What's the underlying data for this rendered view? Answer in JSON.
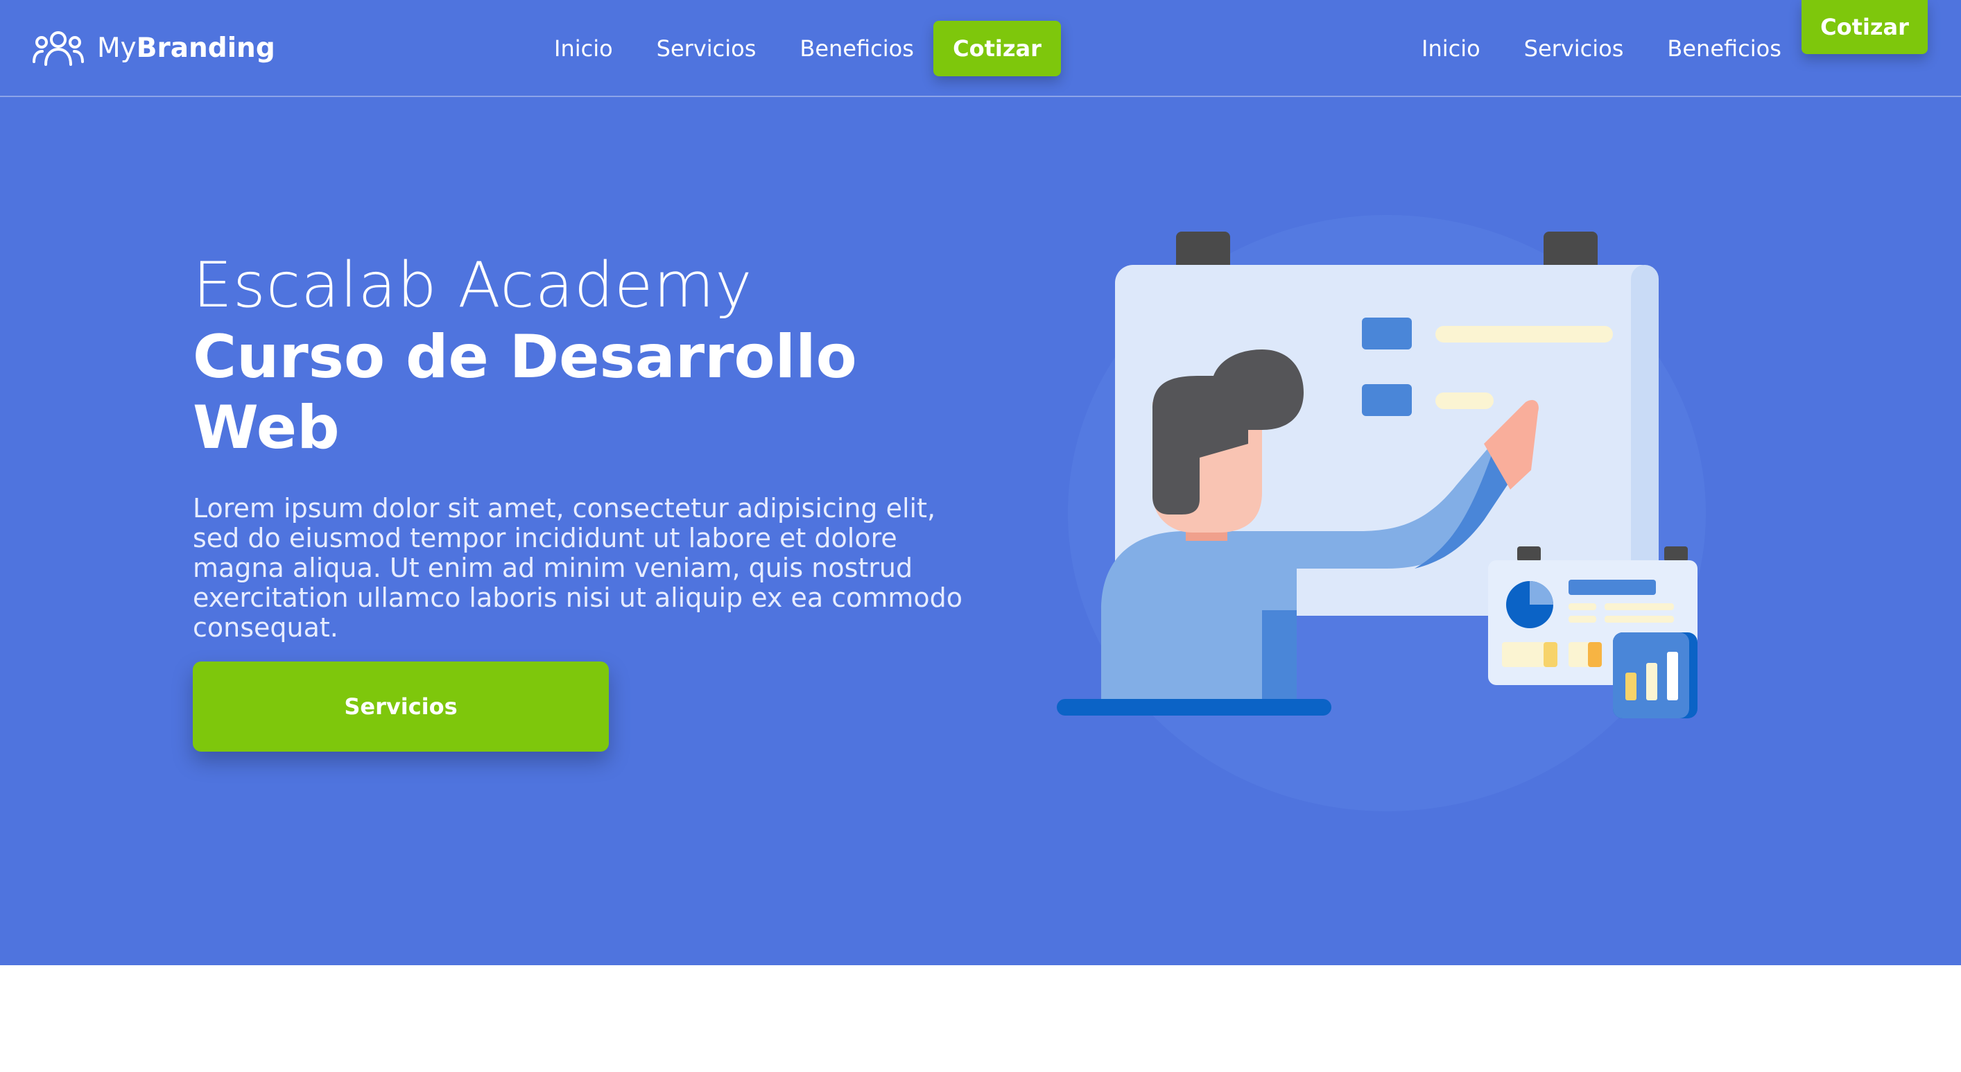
{
  "brand": {
    "name_light": "My",
    "name_bold": "Branding",
    "icon": "users-icon"
  },
  "nav_primary": {
    "items": [
      {
        "label": "Inicio"
      },
      {
        "label": "Servicios"
      },
      {
        "label": "Beneficios"
      }
    ],
    "cta_label": "Cotizar"
  },
  "nav_secondary": {
    "items": [
      {
        "label": "Inicio"
      },
      {
        "label": "Servicios"
      },
      {
        "label": "Beneficios"
      }
    ],
    "cta_label": "Cotizar"
  },
  "hero": {
    "title_light": "Escalab Academy",
    "title_bold": "Curso de Desarrollo Web",
    "description": "Lorem ipsum dolor sit amet, consectetur adipisicing elit, sed do eiusmod tempor incididunt ut labore et dolore magna aliqua. Ut enim ad minim veniam, quis nostrud exercitation ullamco laboris nisi ut aliquip ex ea commodo consequat.",
    "button_label": "Servicios",
    "illustration": "teacher-whiteboard-illustration"
  },
  "colors": {
    "hero_bg": "#4f74de",
    "accent": "#7ec70c",
    "text": "#ffffff"
  }
}
